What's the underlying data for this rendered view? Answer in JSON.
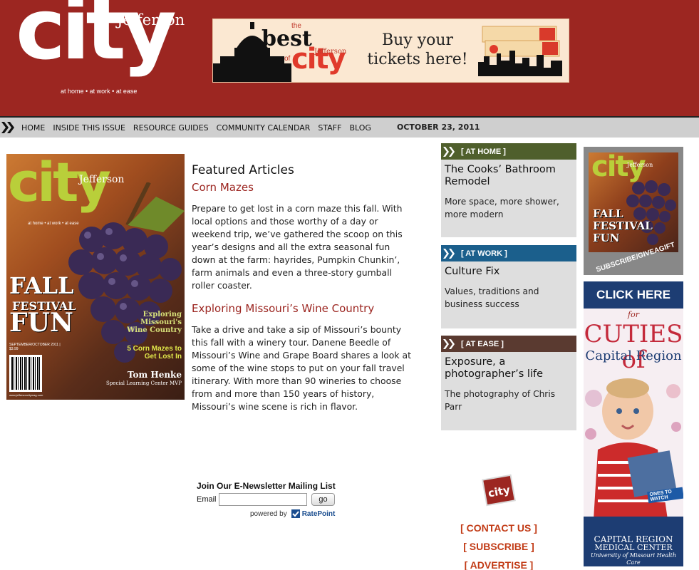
{
  "logo": {
    "wordmark": "city",
    "jefferson": "Jefferson",
    "tagline": "at home • at work • at ease"
  },
  "banner": {
    "the": "the",
    "best": "best",
    "of": "of",
    "city": "city",
    "jefferson": "Jefferson",
    "cta": "Buy your tickets here!"
  },
  "nav": {
    "items": [
      "HOME",
      "INSIDE THIS ISSUE",
      "RESOURCE GUIDES",
      "COMMUNITY CALENDAR",
      "STAFF",
      "BLOG"
    ],
    "date": "OCTOBER 23, 2011"
  },
  "cover": {
    "wordmark": "city",
    "jefferson": "Jefferson",
    "tagline": "at home • at work • at ease",
    "fall": "FALL",
    "festival": "FESTIVAL",
    "fun": "FUN",
    "issue": "SEPTEMBER/OCTOBER 2011 | $3.99",
    "exploring": "Exploring Missouri's Wine Country",
    "mazes": "5 Corn Mazes to Get Lost In",
    "name": "Tom Henke",
    "mvp": "Special Learning Center MVP",
    "url": "www.jeffersoncitymag.com"
  },
  "featured": {
    "heading": "Featured Articles",
    "articles": [
      {
        "title": "Corn Mazes",
        "body": "Prepare to get lost in a corn maze this fall. With local options and those worthy of a day or weekend trip, we’ve gathered the scoop on this year’s designs and all the extra seasonal fun down at the farm: hayrides, Pumpkin Chunkin’, farm animals and even a three-story gumball roller coaster."
      },
      {
        "title": "Exploring Missouri’s Wine Country",
        "body": "Take a drive and take a sip of Missouri’s bounty this fall with a winery tour. Danene Beedle of Missouri’s Wine and Grape Board shares a look at some of the wine stops to put on your fall travel itinerary. With more than 90 wineries to choose from and more than 150 years of history, Missouri’s wine scene is rich in flavor."
      }
    ]
  },
  "newsletter": {
    "title": "Join Our E-Newsletter Mailing List",
    "email_label": "Email",
    "email_value": "",
    "go_label": "go",
    "powered_by": "powered by",
    "provider": "RatePoint"
  },
  "sections": [
    {
      "label": "[ AT HOME ]",
      "color": "#4f5f2c",
      "title": "The Cooks’ Bathroom Remodel",
      "desc": "More space, more shower, more modern"
    },
    {
      "label": "[ AT WORK ]",
      "color": "#1b5f8c",
      "title": "Culture Fix",
      "desc": "Values, traditions and business success"
    },
    {
      "label": "[ AT EASE ]",
      "color": "#5a3a30",
      "title": "Exposure, a photographer’s life",
      "desc": "The photography of Chris Parr"
    }
  ],
  "subscribe": {
    "wordmark": "city",
    "jefferson": "Jefferson",
    "fall": "FALL FESTIVAL FUN",
    "label": "SUBSCRIBE/GIVEAGIFT"
  },
  "cuties_ad": {
    "click": "CLICK HERE",
    "for": "for",
    "cuties": "CUTIES of",
    "region": "Capital Region",
    "watch": "ONES TO WATCH",
    "sponsor_1": "CAPITAL REGION",
    "sponsor_2": "MEDICAL CENTER",
    "sponsor_3": "University of Missouri Health Care"
  },
  "small_logo": {
    "wordmark": "city"
  },
  "footer_links": [
    "[ CONTACT US ]",
    "[ SUBSCRIBE ]",
    "[ ADVERTISE ]"
  ],
  "colors": {
    "brand_red": "#9c2621",
    "nav_gray": "#cfcfcf",
    "link_orange": "#c23b16",
    "at_home": "#4f5f2c",
    "at_work": "#1b5f8c",
    "at_ease": "#5a3a30"
  }
}
